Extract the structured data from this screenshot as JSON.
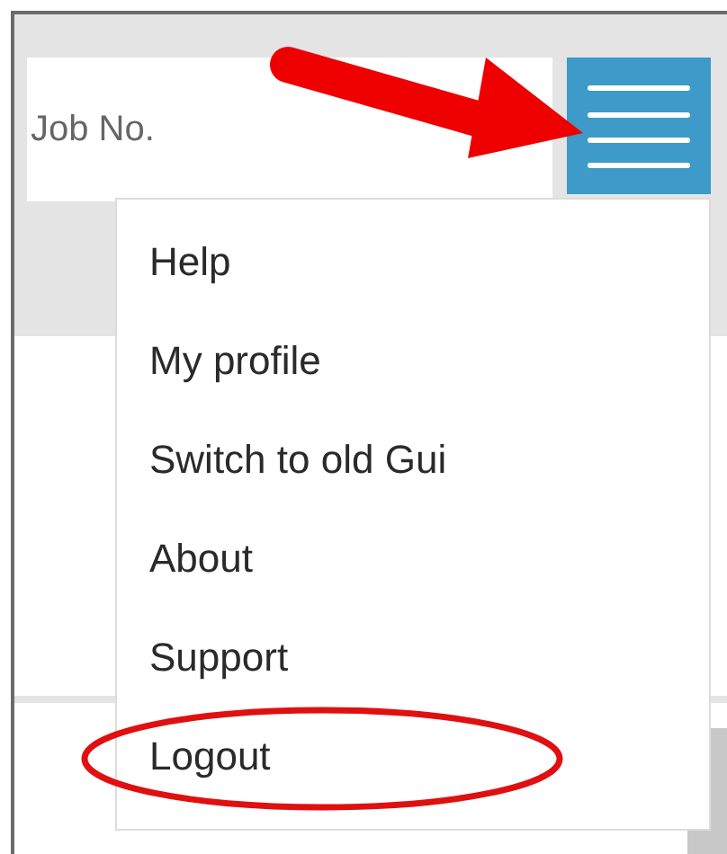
{
  "search": {
    "placeholder": "Job No."
  },
  "menu_button": {
    "expanded": true
  },
  "menu": {
    "items": [
      {
        "label": "Help",
        "circled": false
      },
      {
        "label": "My profile",
        "circled": false
      },
      {
        "label": "Switch to old Gui",
        "circled": false
      },
      {
        "label": "About",
        "circled": false
      },
      {
        "label": "Support",
        "circled": false
      },
      {
        "label": "Logout",
        "circled": true
      }
    ]
  }
}
